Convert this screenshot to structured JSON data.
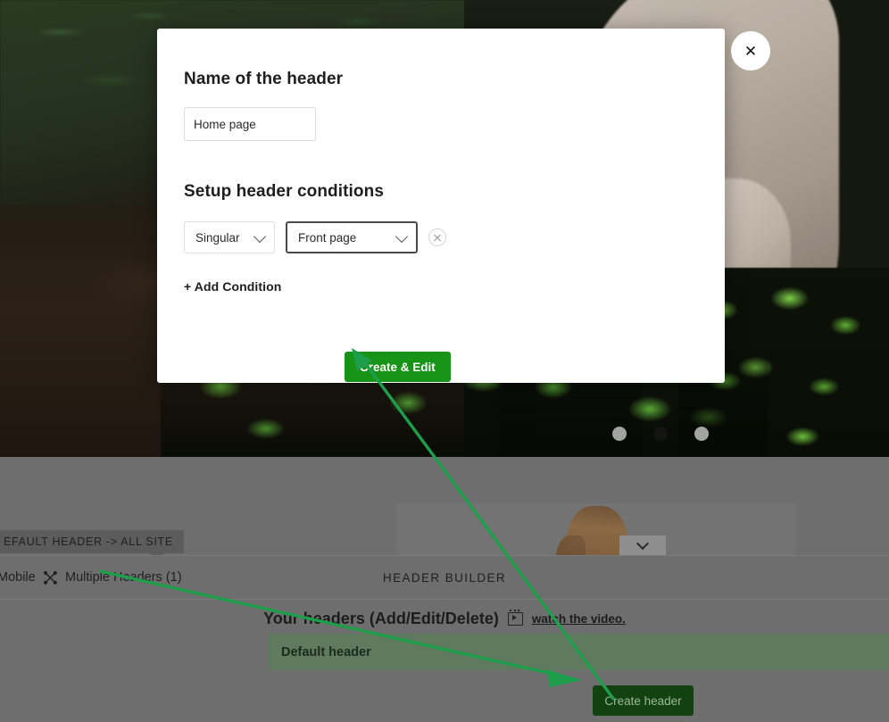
{
  "background": {
    "scene_description": "dark garden photo with grass, soil, leaves and a person in light clothing",
    "carousel": {
      "dots": [
        "inactive",
        "active",
        "inactive"
      ],
      "active_index": 1
    }
  },
  "modal": {
    "close_label": "✕",
    "name_section": {
      "title": "Name of the header",
      "input_value": "Home page",
      "input_placeholder": "Home page"
    },
    "conditions_section": {
      "title": "Setup header conditions",
      "rows": [
        {
          "type_value": "Singular",
          "target_value": "Front page",
          "remove_label": "✕"
        }
      ],
      "add_condition_label": "+ Add Condition"
    },
    "primary_button": "Create & Edit"
  },
  "admin": {
    "tooltip": "EFAULT HEADER -> ALL SITE",
    "toolbar": {
      "mobile_label": "Mobile",
      "multiple_headers_label": "Multiple Headers (1)",
      "center_title": "HEADER BUILDER"
    },
    "headers_panel": {
      "title": "Your headers (Add/Edit/Delete)",
      "watch_video_label": "watch the video.",
      "rows": [
        {
          "name": "Default header"
        }
      ],
      "create_button": "Create header"
    },
    "preview": {
      "chevron_label": "⌄"
    }
  },
  "colors": {
    "primary_green": "#179417",
    "create_header_green": "#11420f",
    "header_row_green": "#5f7a5f",
    "annotation_green": "#1e9e4a",
    "dim_overlay": "#6e6e6e",
    "modal_bg": "#ffffff",
    "focused_border": "#4a4a4a"
  }
}
